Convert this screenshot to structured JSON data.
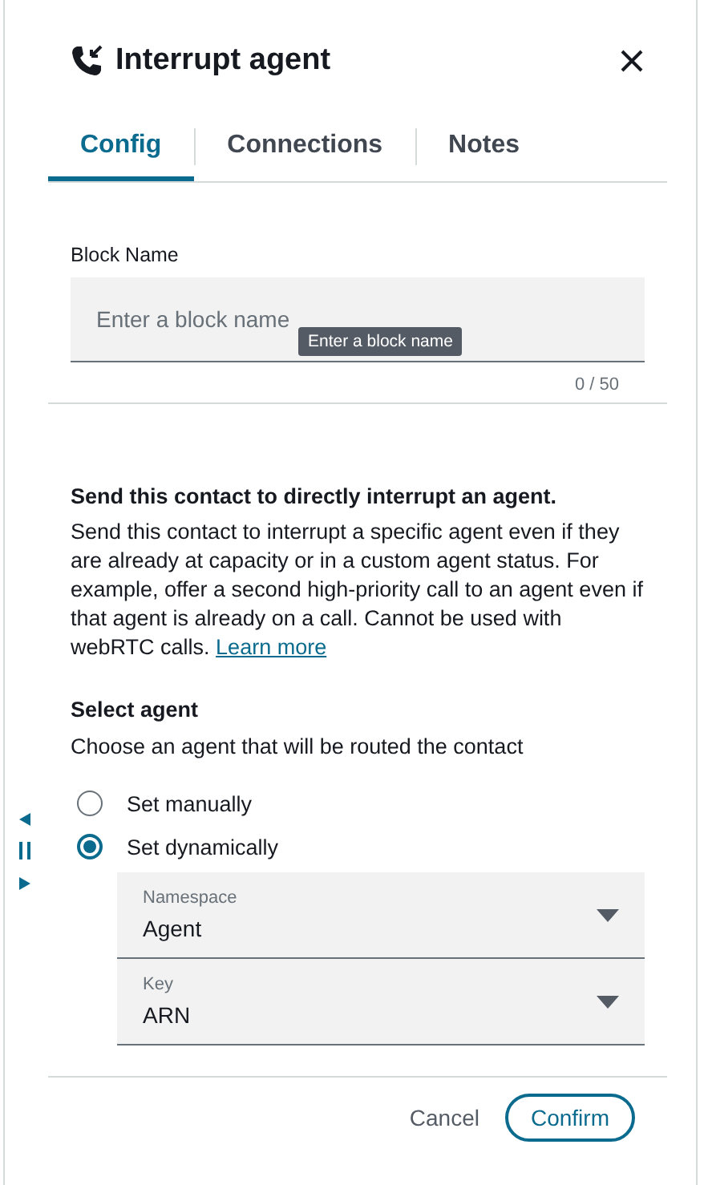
{
  "header": {
    "title": "Interrupt agent"
  },
  "tabs": [
    {
      "label": "Config",
      "selected": true
    },
    {
      "label": "Connections",
      "selected": false
    },
    {
      "label": "Notes",
      "selected": false
    }
  ],
  "block_name": {
    "label": "Block Name",
    "placeholder": "Enter a block name",
    "tooltip": "Enter a block name",
    "counter": "0 / 50"
  },
  "description": {
    "heading": "Send this contact to directly interrupt an agent.",
    "text": "Send this contact to interrupt a specific agent even if they are already at capacity or in a custom agent status. For example, offer a second high-priority call to an agent even if that agent is already on a call. Cannot be used with webRTC calls.",
    "link": "Learn more"
  },
  "select_agent": {
    "heading": "Select agent",
    "hint": "Choose an agent that will be routed the contact",
    "options": [
      {
        "label": "Set manually",
        "selected": false
      },
      {
        "label": "Set dynamically",
        "selected": true
      }
    ]
  },
  "selects": [
    {
      "label": "Namespace",
      "value": "Agent"
    },
    {
      "label": "Key",
      "value": "ARN"
    }
  ],
  "buttons": [
    {
      "label": "Cancel",
      "kind": "secondary"
    },
    {
      "label": "Confirm",
      "kind": "primary"
    }
  ]
}
